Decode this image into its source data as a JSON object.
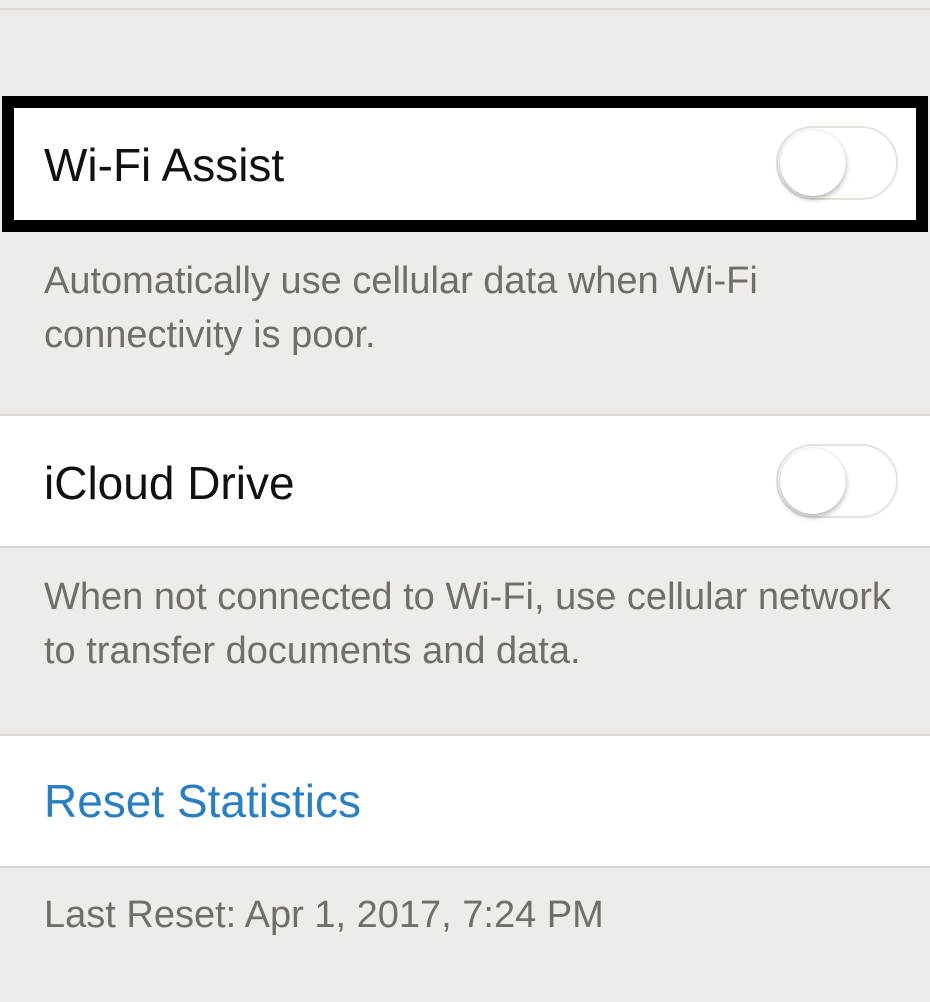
{
  "wifi_assist": {
    "label": "Wi-Fi Assist",
    "enabled": false,
    "footer": "Automatically use cellular data when Wi-Fi connectivity is poor."
  },
  "icloud_drive": {
    "label": "iCloud Drive",
    "enabled": false,
    "footer": "When not connected to Wi-Fi, use cellular network to transfer documents and data."
  },
  "reset": {
    "label": "Reset Statistics",
    "last_reset": "Last Reset: Apr 1, 2017, 7:24 PM"
  },
  "colors": {
    "link": "#2a7fc0",
    "highlight_border": "#000000",
    "background": "#efebe8"
  }
}
